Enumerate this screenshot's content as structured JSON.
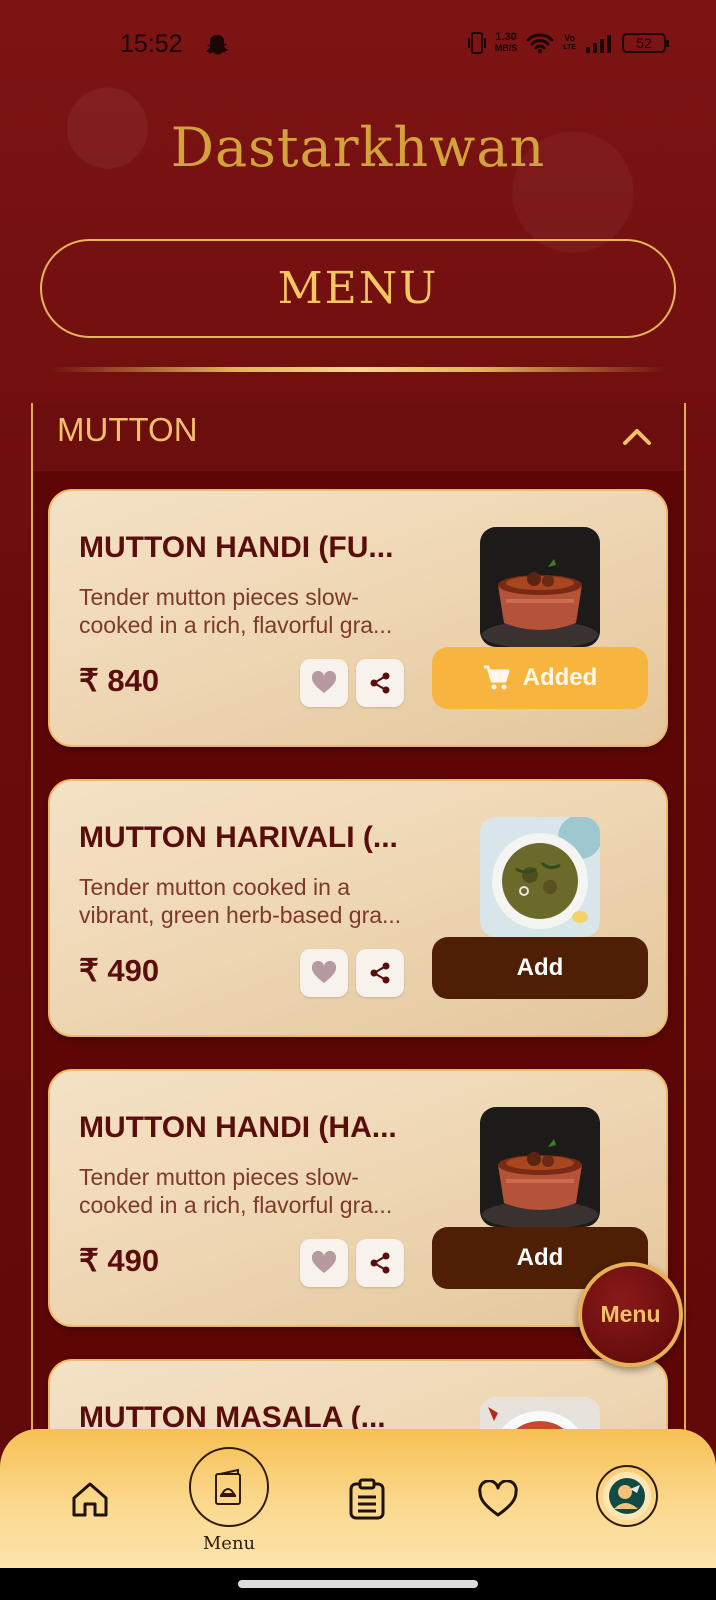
{
  "status_bar": {
    "time": "15:52",
    "net_speed_value": "1.30",
    "net_speed_unit": "MB/S",
    "volte_top": "Vo",
    "volte_bottom": "LTE",
    "battery": "52"
  },
  "brand": {
    "logo_text": "Dastarkhwan",
    "accent_color": "#d4a23a",
    "background_color": "#6e0b0b"
  },
  "header": {
    "title": "MENU"
  },
  "category": {
    "title": "MUTTON",
    "icon": "chevron-up-icon",
    "items": [
      {
        "name": "MUTTON HANDI (FU...",
        "desc_line1": "Tender mutton pieces slow-",
        "desc_line2": "cooked in a rich, flavorful gra...",
        "price": "₹ 840",
        "button_label": "Added",
        "button_state": "added",
        "photo": "handi-dish"
      },
      {
        "name": "MUTTON HARIVALI (...",
        "desc_line1": "Tender mutton cooked in a",
        "desc_line2": "vibrant, green herb-based gra...",
        "price": "₹ 490",
        "button_label": "Add",
        "button_state": "add",
        "photo": "harivali-dish"
      },
      {
        "name": "MUTTON HANDI (HA...",
        "desc_line1": "Tender mutton pieces slow-",
        "desc_line2": "cooked in a rich, flavorful gra...",
        "price": "₹ 490",
        "button_label": "Add",
        "button_state": "add",
        "photo": "handi-dish"
      },
      {
        "name": "MUTTON MASALA (...",
        "photo": "masala-dish"
      }
    ]
  },
  "fab": {
    "label": "Menu"
  },
  "bottom_nav": {
    "items": [
      {
        "icon": "home-icon"
      },
      {
        "icon": "menu-book-icon",
        "label": "Menu"
      },
      {
        "icon": "orders-clipboard-icon"
      },
      {
        "icon": "heart-icon"
      },
      {
        "icon": "profile-avatar-icon"
      }
    ]
  }
}
